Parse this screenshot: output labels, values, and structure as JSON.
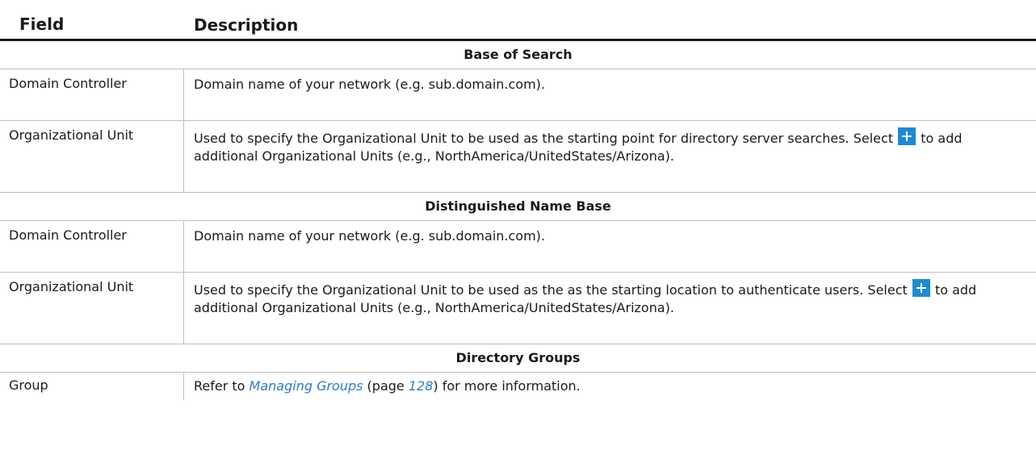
{
  "header": {
    "field": "Field",
    "description": "Description"
  },
  "sections": [
    {
      "title": "Base of Search",
      "rows": [
        {
          "field": "Domain Controller",
          "description": "Domain name of your network (e.g. sub.domain.com)."
        },
        {
          "field": "Organizational Unit",
          "description_before_icon": "Used to specify the Organizational Unit to be used as the starting point for directory server searches. Select ",
          "description_after_icon": " to add additional Organizational Units (e.g., NorthAmerica/UnitedStates/Arizona).",
          "icon": "add-plus-icon"
        }
      ]
    },
    {
      "title": "Distinguished Name Base",
      "rows": [
        {
          "field": "Domain Controller",
          "description": "Domain name of your network (e.g. sub.domain.com)."
        },
        {
          "field": "Organizational Unit",
          "description_before_icon": "Used to specify the Organizational Unit to be used as the as the starting location to authenticate users. Select ",
          "description_after_icon": " to add additional Organizational Units (e.g., NorthAmerica/UnitedStates/Arizona).",
          "icon": "add-plus-icon"
        }
      ]
    },
    {
      "title": "Directory Groups",
      "rows": [
        {
          "field": "Group",
          "description_prefix": "Refer to ",
          "link_text": "Managing Groups",
          "page_prefix": " (page ",
          "page_number": "128",
          "description_suffix": ") for more information."
        }
      ]
    }
  ],
  "colors": {
    "icon_blue": "#1c8bd0",
    "link_blue": "#2e7cc4",
    "rule": "#bfbfbf"
  }
}
